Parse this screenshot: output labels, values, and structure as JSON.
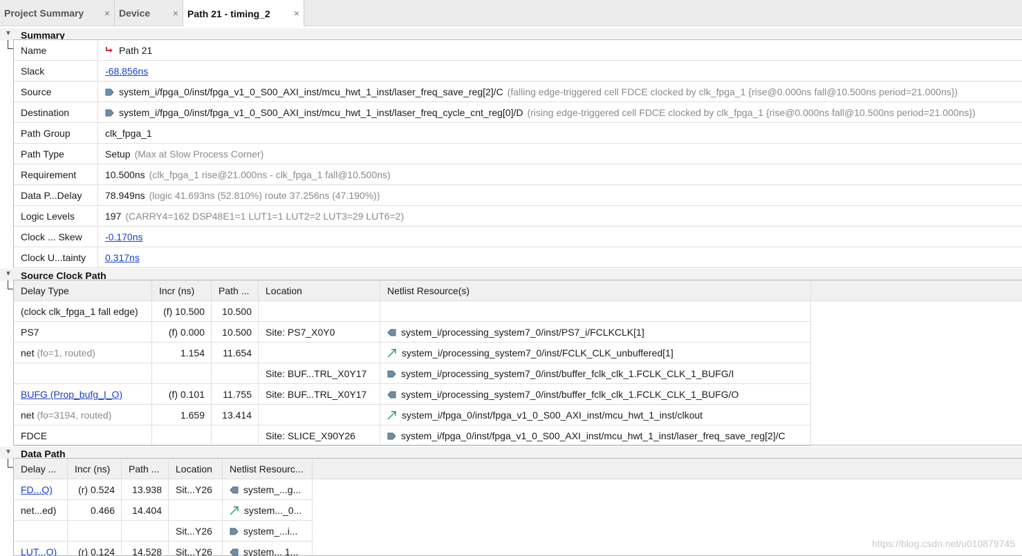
{
  "tabs": [
    {
      "label": "Project Summary",
      "close": "×"
    },
    {
      "label": "Device",
      "close": "×"
    },
    {
      "label": "Path 21 - timing_2",
      "close": "×"
    }
  ],
  "summary": {
    "title": "Summary",
    "rows": [
      {
        "label": "Name",
        "value": "Path 21",
        "icon": "path-icon"
      },
      {
        "label": "Slack",
        "value": "-68.856ns",
        "link": true
      },
      {
        "label": "Source",
        "value": "system_i/fpga_0/inst/fpga_v1_0_S00_AXI_inst/mcu_hwt_1_inst/laser_freq_save_reg[2]/C",
        "note": "(falling edge-triggered cell FDCE clocked by clk_fpga_1  {rise@0.000ns fall@10.500ns period=21.000ns})",
        "icon": "pin-in-icon"
      },
      {
        "label": "Destination",
        "value": "system_i/fpga_0/inst/fpga_v1_0_S00_AXI_inst/mcu_hwt_1_inst/laser_freq_cycle_cnt_reg[0]/D",
        "note": "(rising edge-triggered cell FDCE clocked by clk_fpga_1  {rise@0.000ns fall@10.500ns period=21.000ns})",
        "icon": "pin-in-icon"
      },
      {
        "label": "Path Group",
        "value": "clk_fpga_1"
      },
      {
        "label": "Path Type",
        "value": "Setup",
        "note": "(Max at Slow Process Corner)"
      },
      {
        "label": "Requirement",
        "value": "10.500ns",
        "note": "(clk_fpga_1 rise@21.000ns - clk_fpga_1 fall@10.500ns)"
      },
      {
        "label": "Data P...Delay",
        "value": "78.949ns",
        "note": "(logic 41.693ns (52.810%)  route 37.256ns (47.190%))"
      },
      {
        "label": "Logic Levels",
        "value": "197",
        "note": " (CARRY4=162 DSP48E1=1 LUT1=1 LUT2=2 LUT3=29 LUT6=2)"
      },
      {
        "label": "Clock ... Skew",
        "value": "-0.170ns",
        "link": true
      },
      {
        "label": "Clock U...tainty",
        "value": "0.317ns",
        "link": true
      }
    ]
  },
  "source_clock_path": {
    "title": "Source Clock Path",
    "headers": [
      "Delay Type",
      "Incr (ns)",
      "Path ...",
      "Location",
      "Netlist Resource(s)"
    ],
    "rows": [
      {
        "type": "(clock clk_fpga_1 fall edge)",
        "incr": "(f) 10.500",
        "path": "10.500",
        "loc": "",
        "res": "",
        "icon": ""
      },
      {
        "type": "PS7",
        "incr": "(f) 0.000",
        "path": "10.500",
        "loc": "Site: PS7_X0Y0",
        "res": "system_i/processing_system7_0/inst/PS7_i/FCLKCLK[1]",
        "icon": "pin-out-icon"
      },
      {
        "type": "net",
        "type_note": "(fo=1, routed)",
        "incr": "1.154",
        "path": "11.654",
        "loc": "",
        "res": "system_i/processing_system7_0/inst/FCLK_CLK_unbuffered[1]",
        "icon": "net-icon"
      },
      {
        "type": "",
        "incr": "",
        "path": "",
        "loc": "Site: BUF...TRL_X0Y17",
        "res": "system_i/processing_system7_0/inst/buffer_fclk_clk_1.FCLK_CLK_1_BUFG/I",
        "icon": "pin-in-icon"
      },
      {
        "type": "BUFG (Prop_bufg_I_O)",
        "type_link": true,
        "incr": "(f) 0.101",
        "path": "11.755",
        "loc": "Site: BUF...TRL_X0Y17",
        "res": "system_i/processing_system7_0/inst/buffer_fclk_clk_1.FCLK_CLK_1_BUFG/O",
        "icon": "pin-out-icon"
      },
      {
        "type": "net",
        "type_note": "(fo=3194, routed)",
        "incr": "1.659",
        "path": "13.414",
        "loc": "",
        "res": "system_i/fpga_0/inst/fpga_v1_0_S00_AXI_inst/mcu_hwt_1_inst/clkout",
        "icon": "net-icon"
      },
      {
        "type": "FDCE",
        "incr": "",
        "path": "",
        "loc": "Site: SLICE_X90Y26",
        "res": "system_i/fpga_0/inst/fpga_v1_0_S00_AXI_inst/mcu_hwt_1_inst/laser_freq_save_reg[2]/C",
        "icon": "pin-in-icon"
      }
    ]
  },
  "data_path": {
    "title": "Data Path",
    "headers": [
      "Delay ...",
      "Incr (ns)",
      "Path ...",
      "Location",
      "Netlist Resourc..."
    ],
    "rows": [
      {
        "type": "FD...Q)",
        "type_link": true,
        "incr": "(r) 0.524",
        "path": "13.938",
        "loc": "Sit...Y26",
        "res": "system_...g...",
        "icon": "pin-out-icon"
      },
      {
        "type": "net...ed)",
        "incr": "0.466",
        "path": "14.404",
        "loc": "",
        "res": "system..._0...",
        "icon": "net-icon"
      },
      {
        "type": "",
        "incr": "",
        "path": "",
        "loc": "Sit...Y26",
        "res": "system_...i...",
        "icon": "pin-in-icon"
      },
      {
        "type": "LUT...O)",
        "type_link": true,
        "incr": "(r) 0.124",
        "path": "14.528",
        "loc": "Sit...Y26",
        "res": "system... 1...",
        "icon": "pin-out-icon"
      }
    ]
  },
  "watermark": "https://blog.csdn.net/u010879745",
  "colors": {
    "link": "#1a3fcf",
    "note": "#8a8a8a",
    "net_icon": "#1e9a5a",
    "pin_icon": "#6f8ea6",
    "path_icon": "#d62b2b"
  }
}
